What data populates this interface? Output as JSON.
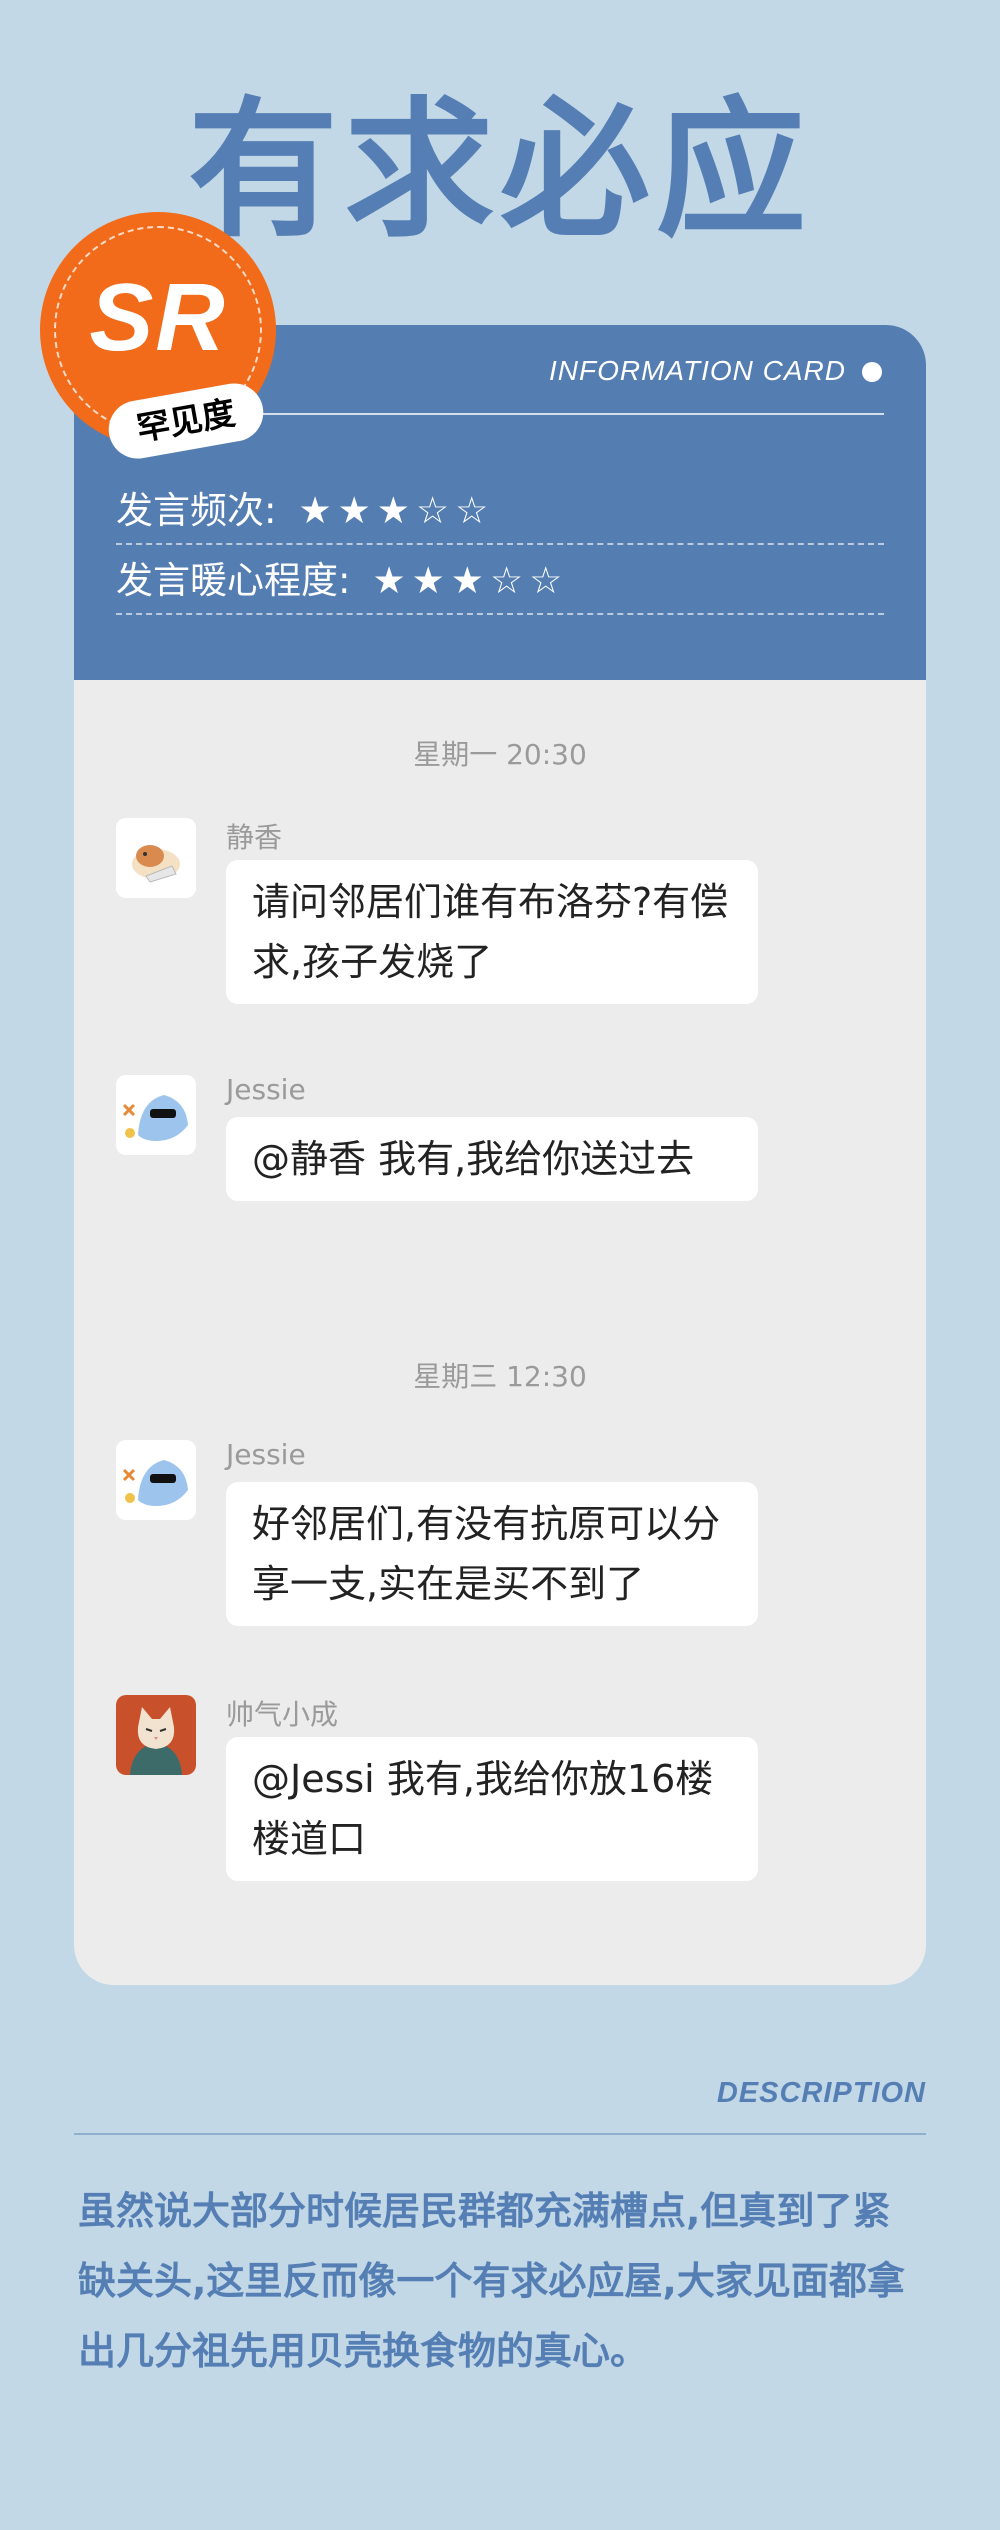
{
  "title": "有求必应",
  "card": {
    "label": "INFORMATION CARD",
    "rarity": "SR",
    "rarity_tag": "罕见度",
    "ratings": [
      {
        "label": "发言频次:",
        "stars": "★★★☆☆",
        "value": 3,
        "max": 5
      },
      {
        "label": "发言暖心程度:",
        "stars": "★★★☆☆",
        "value": 3,
        "max": 5
      }
    ]
  },
  "chat": {
    "time1": "星期一 20:30",
    "time2": "星期三 12:30",
    "messages": [
      {
        "sender": "静香",
        "text": "请问邻居们谁有布洛芬?有偿求,孩子发烧了",
        "avatar": "hamster-avatar"
      },
      {
        "sender": "Jessie",
        "text": "@静香 我有,我给你送过去",
        "avatar": "shark-sunglasses-avatar"
      },
      {
        "sender": "Jessie",
        "text": "好邻居们,有没有抗原可以分享一支,实在是买不到了",
        "avatar": "shark-sunglasses-avatar"
      },
      {
        "sender": "帅气小成",
        "text": "@Jessi 我有,我给你放16楼楼道口",
        "avatar": "cat-avatar"
      }
    ]
  },
  "description": {
    "label": "DESCRIPTION",
    "text": "虽然说大部分时候居民群都充满槽点,但真到了紧缺关头,这里反而像一个有求必应屋,大家见面都拿出几分祖先用贝壳换食物的真心。"
  },
  "colors": {
    "background": "#c2d8e6",
    "accent": "#557fb4",
    "card_header": "#547db1",
    "stamp": "#f26b1a"
  }
}
